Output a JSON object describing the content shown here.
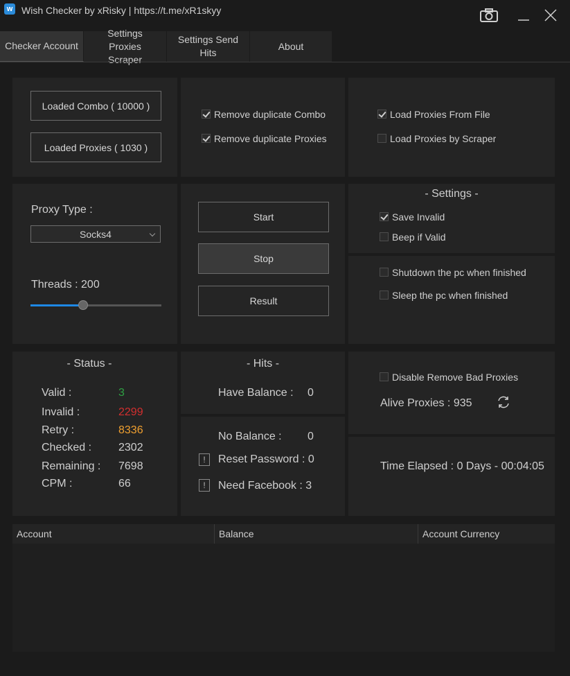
{
  "window": {
    "app_icon": "w",
    "title": "Wish Checker by xRisky | https://t.me/xR1skyy",
    "buttons": [
      "camera-icon",
      "minimize-icon",
      "close-icon"
    ]
  },
  "tabs": [
    {
      "label": "Checker Account",
      "active": true
    },
    {
      "label": "Settings Proxies Scraper",
      "active": false
    },
    {
      "label": "Settings Send Hits",
      "active": false
    },
    {
      "label": "About",
      "active": false
    }
  ],
  "loaders": {
    "combo_label": "Loaded Combo ( 10000 )",
    "proxies_label": "Loaded Proxies ( 1030 )"
  },
  "duplicates": {
    "remove_combo": {
      "label": "Remove duplicate Combo",
      "checked": true
    },
    "remove_proxies": {
      "label": "Remove duplicate Proxies",
      "checked": true
    }
  },
  "proxy_source": {
    "from_file": {
      "label": "Load Proxies From File",
      "checked": true
    },
    "by_scraper": {
      "label": "Load Proxies by Scraper",
      "checked": false
    }
  },
  "proxy_type": {
    "label": "Proxy Type :",
    "selected": "Socks4"
  },
  "threads": {
    "label": "Threads : 200",
    "value": 200,
    "fill_fraction": 0.4
  },
  "controls": {
    "start": "Start",
    "stop": "Stop",
    "result": "Result"
  },
  "settings": {
    "title": "-  Settings  -",
    "save_invalid": {
      "label": "Save Invalid",
      "checked": true
    },
    "beep_valid": {
      "label": "Beep if Valid",
      "checked": false
    },
    "shutdown": {
      "label": "Shutdown the pc when finished",
      "checked": false
    },
    "sleep": {
      "label": "Sleep the pc when finished",
      "checked": false
    }
  },
  "status": {
    "title": "-  Status  -",
    "rows": [
      {
        "label": "Valid :",
        "value": "3",
        "color": "#2ea043"
      },
      {
        "label": "Invalid :",
        "value": "2299",
        "color": "#d32f2f"
      },
      {
        "label": "Retry :",
        "value": "8336",
        "color": "#f0a030"
      },
      {
        "label": "Checked :",
        "value": "2302",
        "color": "#cfcfcf"
      },
      {
        "label": "Remaining :",
        "value": "7698",
        "color": "#cfcfcf"
      },
      {
        "label": "CPM :",
        "value": "66",
        "color": "#cfcfcf"
      }
    ]
  },
  "hits": {
    "title": "-  Hits  -",
    "have_balance_label": "Have Balance :",
    "have_balance_value": "0",
    "no_balance_label": "No Balance :",
    "no_balance_value": "0",
    "reset_password": "Reset Password : 0",
    "need_facebook": "Need Facebook : 3",
    "warn_icon": "!"
  },
  "proxies": {
    "disable_remove_bad": {
      "label": "Disable Remove Bad Proxies",
      "checked": false
    },
    "alive": "Alive Proxies : 935",
    "refresh_icon": "refresh-icon"
  },
  "time": {
    "elapsed": "Time Elapsed : 0 Days - 00:04:05"
  },
  "table": {
    "columns": [
      "Account",
      "Balance",
      "Account Currency"
    ],
    "rows": []
  }
}
